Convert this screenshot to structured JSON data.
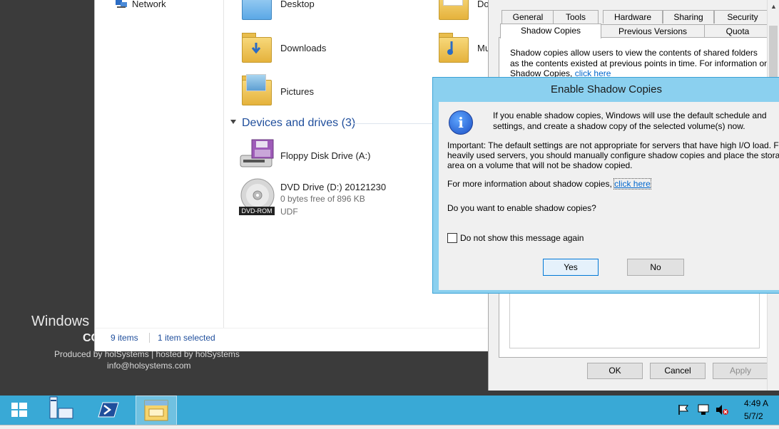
{
  "desktop": {
    "watermark_line1": "Windows",
    "watermark_line2": "CC",
    "watermark_line3": "Produced by holSystems | hosted by holSystems",
    "watermark_line4": "info@holsystems.com"
  },
  "explorer": {
    "nav_network": "Network",
    "folders": [
      {
        "label": "Desktop"
      },
      {
        "label": "Downloads"
      },
      {
        "label": "Pictures"
      }
    ],
    "folders_col2": [
      {
        "label": "Do"
      },
      {
        "label": "Mu"
      }
    ],
    "section_title": "Devices and drives (3)",
    "drives": [
      {
        "title": "Floppy Disk Drive (A:)"
      },
      {
        "title": "DVD Drive (D:) 20121230",
        "free": "0 bytes free of 896 KB",
        "fs": "UDF",
        "badge": "DVD-ROM"
      }
    ],
    "status_items": "9 items",
    "status_selected": "1 item selected"
  },
  "properties": {
    "tabs_row1": [
      "General",
      "Tools",
      "Hardware",
      "Sharing",
      "Security"
    ],
    "tabs_row2": [
      "Shadow Copies",
      "Previous Versions",
      "Quota"
    ],
    "desc_line1": "Shadow copies allow users to view the contents of shared folders",
    "desc_line2": "as the contents existed at previous points in time. For information on",
    "desc_line3": "Shadow Copies,",
    "desc_link": "click here",
    "ok": "OK",
    "cancel": "Cancel",
    "apply": "Apply"
  },
  "shadow_dialog": {
    "title": "Enable Shadow Copies",
    "msg1_line1": "If you enable shadow copies, Windows will use the default schedule and",
    "msg1_line2": "settings, and create a shadow copy of the selected volume(s) now.",
    "msg2_line1": "Important: The default settings are not appropriate for servers that have high I/O load. F",
    "msg2_line2": "heavily used servers, you should manually configure shadow copies and place the stora",
    "msg2_line3": "area on a volume that will not be shadow copied.",
    "more_info": "For more information about shadow copies,",
    "more_info_link": "click here",
    "question": "Do you want to enable shadow copies?",
    "checkbox_label": "Do not show this message again",
    "yes": "Yes",
    "no": "No"
  },
  "taskbar": {
    "time": "4:49 A",
    "date": "5/7/2"
  }
}
